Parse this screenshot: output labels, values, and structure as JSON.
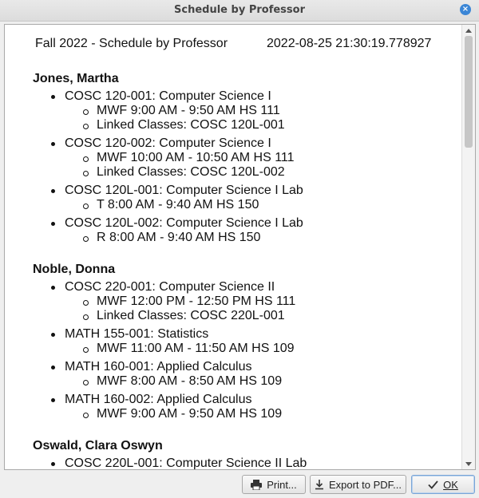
{
  "window": {
    "title": "Schedule by Professor",
    "close_glyph": "×"
  },
  "report": {
    "header_title": "Fall 2022 - Schedule by Professor",
    "header_timestamp": "2022-08-25 21:30:19.778927",
    "professors": [
      {
        "name": "Jones, Martha",
        "courses": [
          {
            "title": "COSC 120-001: Computer Science I",
            "details": [
              "MWF 9:00 AM - 9:50 AM HS 111",
              "Linked Classes: COSC 120L-001"
            ]
          },
          {
            "title": "COSC 120-002: Computer Science I",
            "details": [
              "MWF 10:00 AM - 10:50 AM HS 111",
              "Linked Classes: COSC 120L-002"
            ]
          },
          {
            "title": "COSC 120L-001: Computer Science I Lab",
            "details": [
              "T 8:00 AM - 9:40 AM HS 150"
            ]
          },
          {
            "title": "COSC 120L-002: Computer Science I Lab",
            "details": [
              "R 8:00 AM - 9:40 AM HS 150"
            ]
          }
        ]
      },
      {
        "name": "Noble, Donna",
        "courses": [
          {
            "title": "COSC 220-001: Computer Science II",
            "details": [
              "MWF 12:00 PM - 12:50 PM HS 111",
              "Linked Classes: COSC 220L-001"
            ]
          },
          {
            "title": "MATH 155-001: Statistics",
            "details": [
              "MWF 11:00 AM - 11:50 AM HS 109"
            ]
          },
          {
            "title": "MATH 160-001: Applied Calculus",
            "details": [
              "MWF 8:00 AM - 8:50 AM HS 109"
            ]
          },
          {
            "title": "MATH 160-002: Applied Calculus",
            "details": [
              "MWF 9:00 AM - 9:50 AM HS 109"
            ]
          }
        ]
      },
      {
        "name": "Oswald, Clara Oswyn",
        "courses": [
          {
            "title": "COSC 220L-001: Computer Science II Lab",
            "details": []
          }
        ]
      }
    ]
  },
  "buttons": {
    "print_label": "Print...",
    "export_label": "Export to PDF...",
    "ok_label": "OK"
  },
  "icons": {
    "print": "printer-icon",
    "export": "download-icon",
    "ok": "checkmark-icon"
  }
}
